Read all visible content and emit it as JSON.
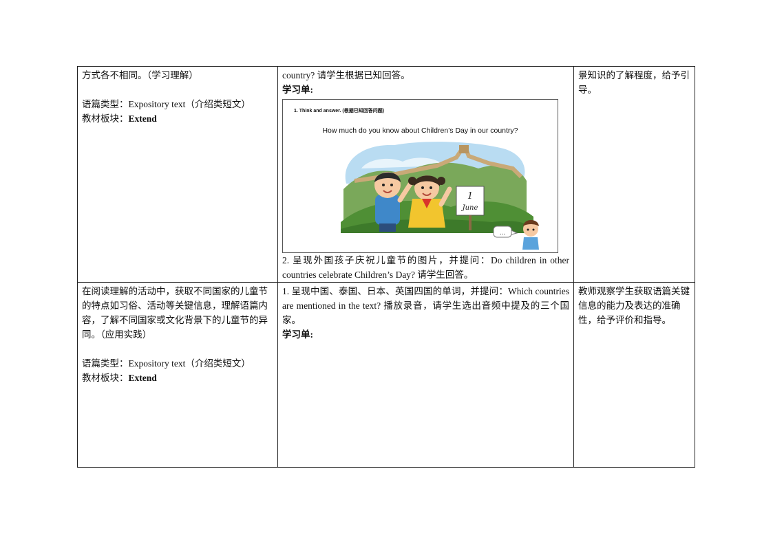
{
  "row1": {
    "col1": {
      "objective": "方式各不相同。（学习理解）",
      "genre_label": "语篇类型：",
      "genre_value": "Expository text（介绍类短文）",
      "module_label": "教材板块：",
      "module_value": "Extend"
    },
    "col2": {
      "intro_text": "country? 请学生根据已知回答。",
      "worksheet_label": "学习单:",
      "worksheet": {
        "heading": "1. Think and answer. (根据已知回答问题)",
        "question": "How much do you know about Children’s Day in our country?",
        "sign_number": "1",
        "sign_month": "June",
        "speech_bubble": "..."
      },
      "step2_text": "2. 呈现外国孩子庆祝儿童节的图片，并提问：Do children in other countries celebrate Children’s Day? 请学生回答。"
    },
    "col3": {
      "assessment": "景知识的了解程度，给予引导。"
    }
  },
  "row2": {
    "col1": {
      "objective": "在阅读理解的活动中，获取不同国家的儿童节的特点如习俗、活动等关键信息，理解语篇内容，了解不同国家或文化背景下的儿童节的异同。（应用实践）",
      "genre_label": "语篇类型：",
      "genre_value": "Expository text（介绍类短文）",
      "module_label": "教材板块：",
      "module_value": "Extend"
    },
    "col2": {
      "step1_text": "1. 呈现中国、泰国、日本、英国四国的单词，并提问：Which countries are mentioned in the text? 播放录音，请学生选出音频中提及的三个国家。",
      "worksheet_label": "学习单:"
    },
    "col3": {
      "assessment": "教师观察学生获取语篇关键信息的能力及表达的准确性，给予评价和指导。"
    }
  }
}
